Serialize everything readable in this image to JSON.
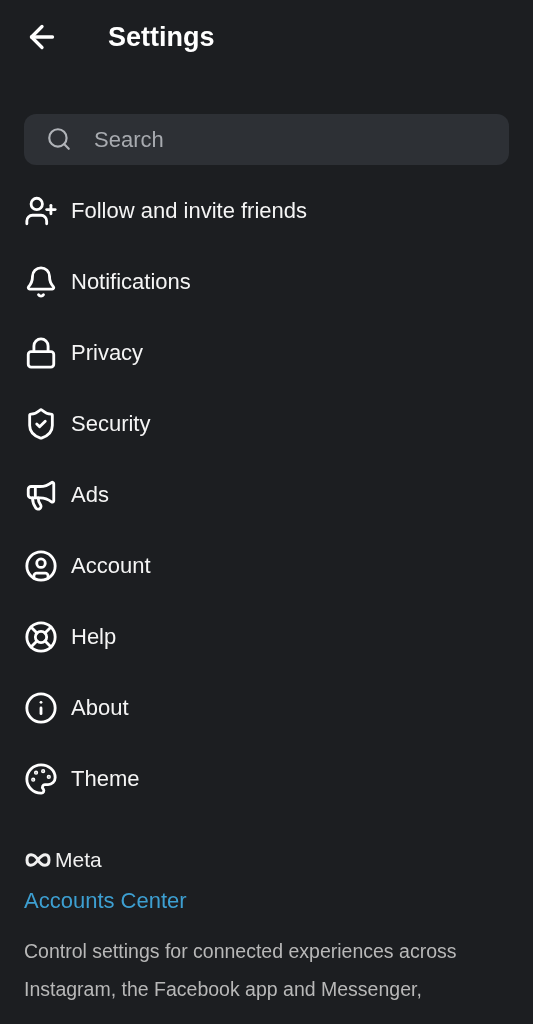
{
  "header": {
    "title": "Settings"
  },
  "search": {
    "placeholder": "Search"
  },
  "items": [
    {
      "kind": "follow",
      "label": "Follow and invite friends"
    },
    {
      "kind": "notifications",
      "label": "Notifications"
    },
    {
      "kind": "privacy",
      "label": "Privacy"
    },
    {
      "kind": "security",
      "label": "Security"
    },
    {
      "kind": "ads",
      "label": "Ads"
    },
    {
      "kind": "account",
      "label": "Account"
    },
    {
      "kind": "help",
      "label": "Help"
    },
    {
      "kind": "about",
      "label": "About"
    },
    {
      "kind": "theme",
      "label": "Theme"
    }
  ],
  "meta": {
    "logo": "Meta",
    "link": "Accounts Center",
    "description": "Control settings for connected experiences across Instagram, the Facebook app and Messenger,"
  }
}
